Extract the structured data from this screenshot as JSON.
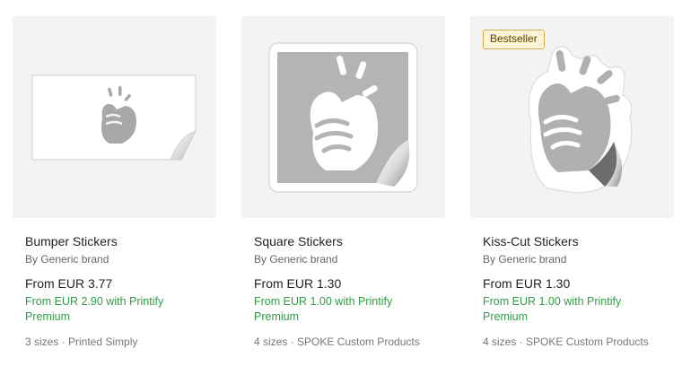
{
  "products": [
    {
      "title": "Bumper Stickers",
      "brand": "By Generic brand",
      "price": "From EUR 3.77",
      "premium": "From EUR 2.90 with Printify Premium",
      "meta": "3 sizes · Printed Simply",
      "badge": null
    },
    {
      "title": "Square Stickers",
      "brand": "By Generic brand",
      "price": "From EUR 1.30",
      "premium": "From EUR 1.00 with Printify Premium",
      "meta": "4 sizes · SPOKE Custom Products",
      "badge": null
    },
    {
      "title": "Kiss-Cut Stickers",
      "brand": "By Generic brand",
      "price": "From EUR 1.30",
      "premium": "From EUR 1.00 with Printify Premium",
      "meta": "4 sizes · SPOKE Custom Products",
      "badge": "Bestseller"
    }
  ],
  "colors": {
    "premium": "#2f9e44",
    "badge_bg": "#fdf3d6",
    "badge_border": "#d1ad4e",
    "thumb_bg": "#f3f3f3"
  }
}
